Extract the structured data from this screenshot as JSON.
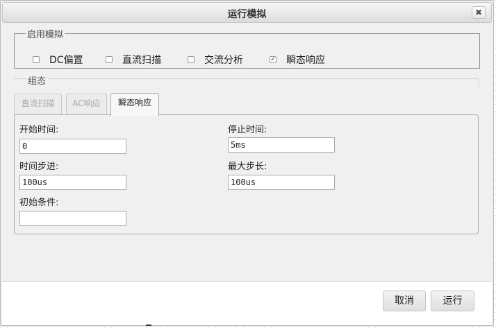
{
  "dialog": {
    "title": "运行模拟",
    "close_label": "✖"
  },
  "sim_options": {
    "legend": "启用模拟",
    "items": [
      {
        "label": "DC偏置",
        "checked": false
      },
      {
        "label": "直流扫描",
        "checked": false
      },
      {
        "label": "交流分析",
        "checked": false
      },
      {
        "label": "瞬态响应",
        "checked": true
      }
    ]
  },
  "config": {
    "title": "组态",
    "tabs": [
      {
        "label": "直流扫描",
        "active": false
      },
      {
        "label": "AC响应",
        "active": false
      },
      {
        "label": "瞬态响应",
        "active": true
      }
    ],
    "fields": {
      "start_time": {
        "label": "开始时间:",
        "value": "0"
      },
      "stop_time": {
        "label": "停止时间:",
        "value": "5ms"
      },
      "time_step": {
        "label": "时间步进:",
        "value": "100us"
      },
      "max_step": {
        "label": "最大步长:",
        "value": "100us"
      },
      "initial_conditions": {
        "label": "初始条件:",
        "value": ""
      }
    }
  },
  "footer": {
    "cancel_label": "取消",
    "run_label": "运行"
  }
}
